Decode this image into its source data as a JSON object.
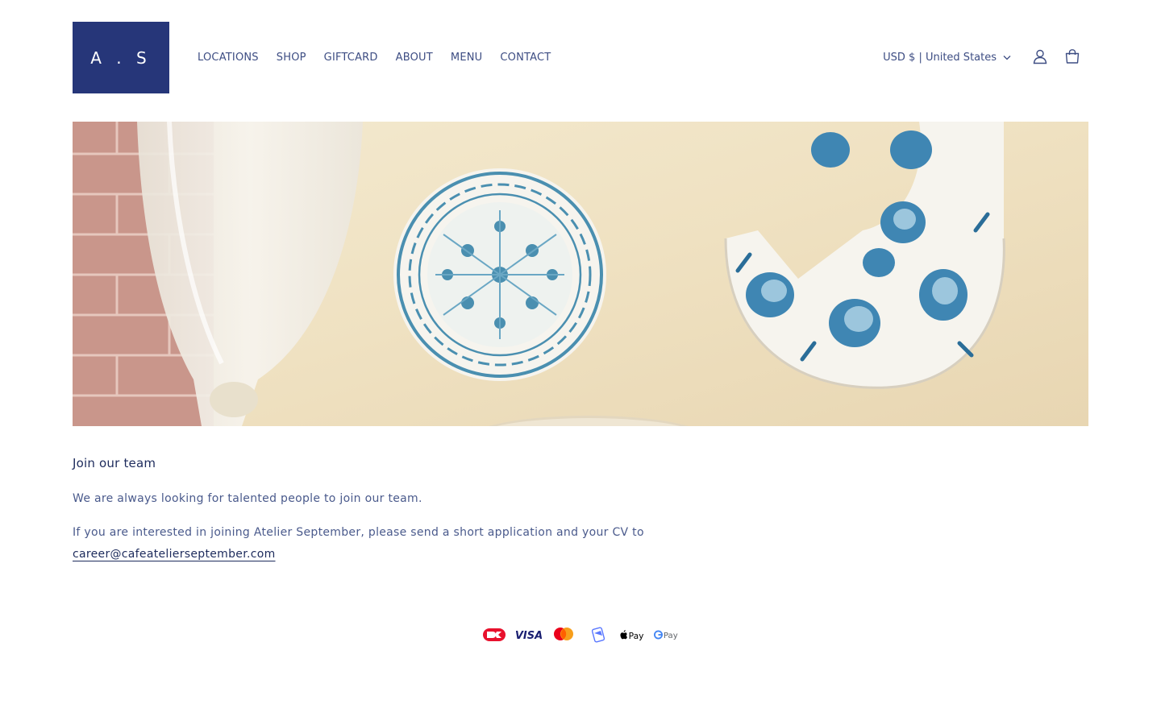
{
  "logo": {
    "text": "A . S"
  },
  "nav": {
    "items": [
      {
        "label": "LOCATIONS"
      },
      {
        "label": "SHOP"
      },
      {
        "label": "GIFTCARD"
      },
      {
        "label": "ABOUT"
      },
      {
        "label": "MENU"
      },
      {
        "label": "CONTACT"
      }
    ]
  },
  "header": {
    "currency": "USD $ | United States",
    "icons": [
      "chevron-down-icon",
      "account-icon",
      "cart-icon"
    ]
  },
  "hero": {
    "description_icons": [
      "hero-image"
    ]
  },
  "content": {
    "title": "Join our team",
    "paragraph1": "We are always looking for talented people to join our team.",
    "paragraph2": "If you are interested in joining Atelier September, please send a short application and your CV to",
    "email": "career@cafeatelierseptember.com"
  },
  "payments": {
    "methods": [
      "Dankort",
      "Visa",
      "Mastercard",
      "MobilePay",
      "Apple Pay",
      "Google Pay"
    ],
    "labels": {
      "visa": "VISA",
      "apple": "Pay",
      "google": "Pay"
    }
  },
  "colors": {
    "brand": "#263679",
    "text": "#3d4d83",
    "heading": "#1d2b5c"
  }
}
